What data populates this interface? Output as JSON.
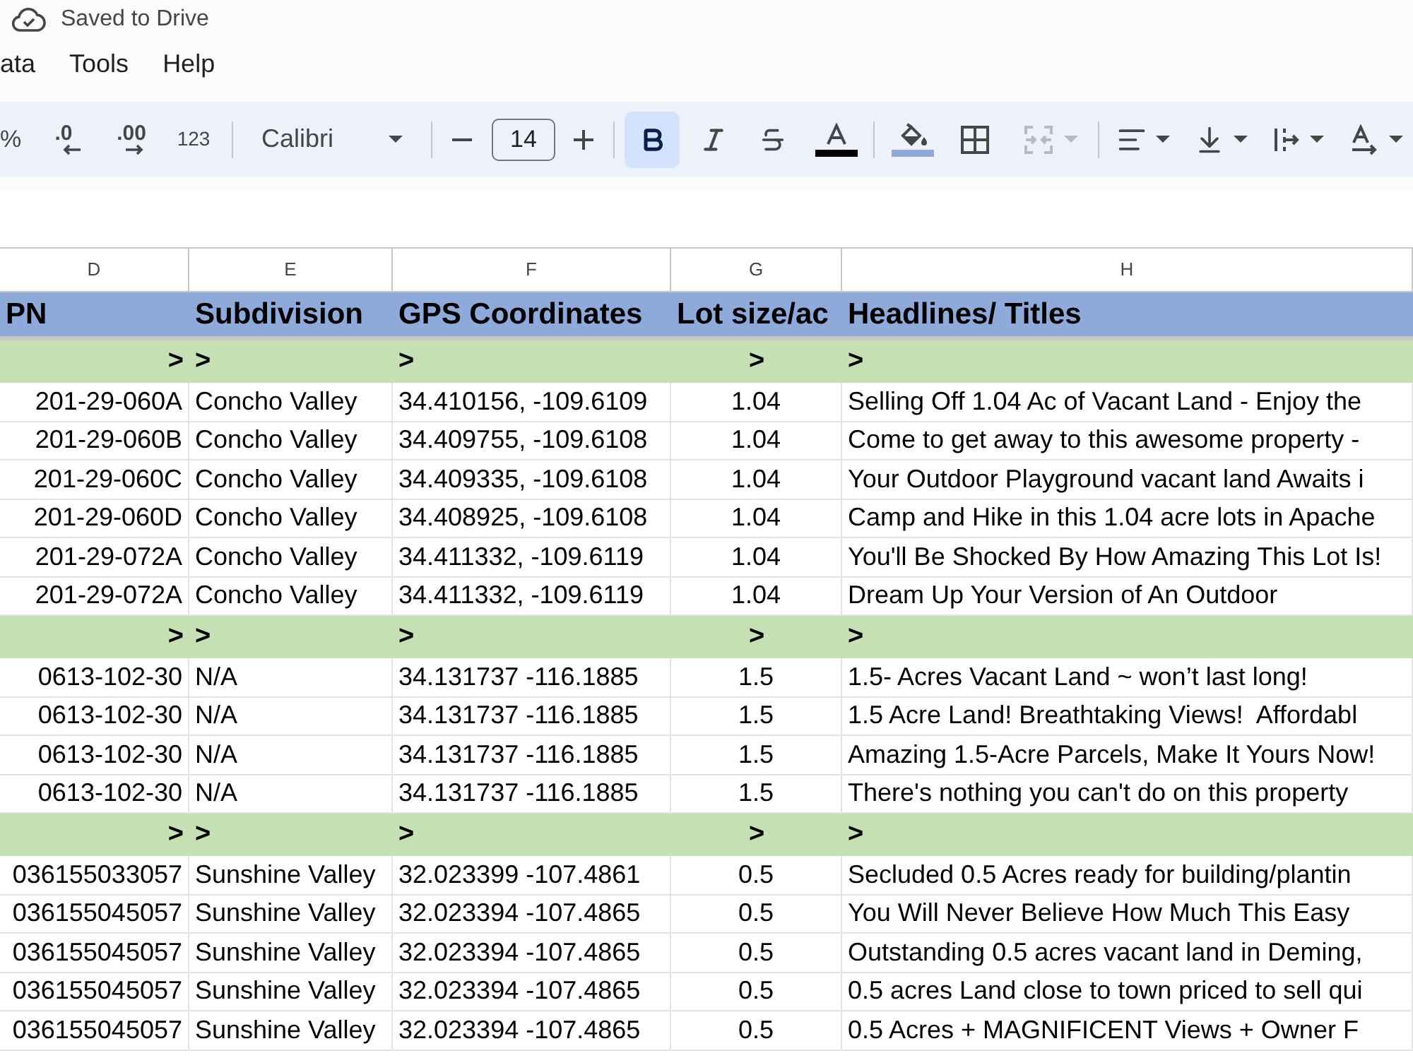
{
  "save_status": "Saved to Drive",
  "menu": [
    "ata",
    "Tools",
    "Help"
  ],
  "toolbar": {
    "percent": "%",
    "decrease_decimal": ".0",
    "increase_decimal": ".00",
    "number_format": "123",
    "font": "Calibri",
    "font_size": "14",
    "format_buttons": [
      {
        "kind": "bold",
        "active": true
      },
      {
        "kind": "italic",
        "active": false
      },
      {
        "kind": "strikethrough",
        "active": false
      }
    ],
    "merge": {
      "disabled": true
    }
  },
  "sheet": {
    "columns": [
      "D",
      "E",
      "F",
      "G",
      "H"
    ],
    "rows": [
      {
        "kind": "header",
        "cells": [
          "PN",
          "Subdivision",
          "GPS Coordinates",
          "Lot size/ac",
          "Headlines/ Titles"
        ]
      },
      {
        "kind": "group",
        "cells": [
          ">",
          ">",
          ">",
          ">",
          ">"
        ]
      },
      {
        "kind": "data",
        "cells": [
          "201-29-060A",
          "Concho Valley",
          "34.410156, -109.6109",
          "1.04",
          "Selling Off 1.04 Ac of Vacant Land - Enjoy the"
        ]
      },
      {
        "kind": "data",
        "cells": [
          "201-29-060B",
          "Concho Valley",
          "34.409755, -109.6108",
          "1.04",
          "Come to get away to this awesome property -"
        ]
      },
      {
        "kind": "data",
        "cells": [
          "201-29-060C",
          "Concho Valley",
          "34.409335, -109.6108",
          "1.04",
          "Your Outdoor Playground vacant land Awaits i"
        ]
      },
      {
        "kind": "data",
        "cells": [
          "201-29-060D",
          "Concho Valley",
          "34.408925, -109.6108",
          "1.04",
          "Camp and Hike in this 1.04 acre lots in Apache"
        ]
      },
      {
        "kind": "data",
        "cells": [
          "201-29-072A",
          "Concho Valley",
          "34.411332, -109.6119",
          "1.04",
          "You'll Be Shocked By How Amazing This Lot Is!"
        ]
      },
      {
        "kind": "data",
        "cells": [
          "201-29-072A",
          "Concho Valley",
          "34.411332, -109.6119",
          "1.04",
          "Dream Up Your Version of An Outdoor"
        ]
      },
      {
        "kind": "group",
        "cells": [
          ">",
          ">",
          ">",
          ">",
          ">"
        ]
      },
      {
        "kind": "data",
        "cells": [
          "0613-102-30",
          "N/A",
          "34.131737 -116.1885",
          "1.5",
          "1.5- Acres Vacant Land ~ won’t last long!"
        ]
      },
      {
        "kind": "data",
        "cells": [
          "0613-102-30",
          "N/A",
          "34.131737 -116.1885",
          "1.5",
          "1.5 Acre Land! Breathtaking Views!  Affordabl"
        ]
      },
      {
        "kind": "data",
        "cells": [
          "0613-102-30",
          "N/A",
          "34.131737 -116.1885",
          "1.5",
          "Amazing 1.5-Acre Parcels, Make It Yours Now!"
        ]
      },
      {
        "kind": "data",
        "cells": [
          "0613-102-30",
          "N/A",
          "34.131737 -116.1885",
          "1.5",
          "There's nothing you can't do on this property"
        ]
      },
      {
        "kind": "group",
        "cells": [
          ">",
          ">",
          ">",
          ">",
          ">"
        ]
      },
      {
        "kind": "data",
        "cells": [
          "036155033057",
          "Sunshine Valley",
          "32.023399 -107.4861",
          "0.5",
          "Secluded 0.5 Acres ready for building/plantin"
        ]
      },
      {
        "kind": "data",
        "cells": [
          "036155045057",
          "Sunshine Valley",
          "32.023394 -107.4865",
          "0.5",
          "You Will Never Believe How Much This Easy"
        ]
      },
      {
        "kind": "data",
        "cells": [
          "036155045057",
          "Sunshine Valley",
          "32.023394 -107.4865",
          "0.5",
          "Outstanding 0.5 acres vacant land in Deming,"
        ]
      },
      {
        "kind": "data",
        "cells": [
          "036155045057",
          "Sunshine Valley",
          "32.023394 -107.4865",
          "0.5",
          "0.5 acres Land close to town priced to sell qui"
        ]
      },
      {
        "kind": "data",
        "cells": [
          "036155045057",
          "Sunshine Valley",
          "32.023394 -107.4865",
          "0.5",
          "0.5 Acres + MAGNIFICENT Views + Owner F"
        ]
      }
    ]
  }
}
